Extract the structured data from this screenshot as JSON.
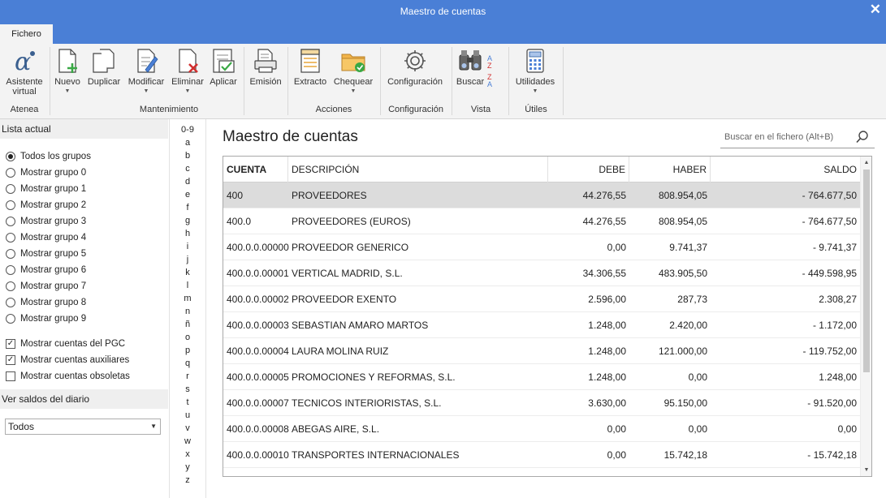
{
  "window": {
    "title": "Maestro de cuentas",
    "close_symbol": "✕"
  },
  "tabs": [
    {
      "label": "Fichero"
    }
  ],
  "ribbon": {
    "buttons": {
      "asistente": {
        "label1": "Asistente",
        "label2": "virtual"
      },
      "nuevo": {
        "label": "Nuevo"
      },
      "duplicar": {
        "label": "Duplicar"
      },
      "modificar": {
        "label": "Modificar"
      },
      "eliminar": {
        "label": "Eliminar"
      },
      "aplicar": {
        "label": "Aplicar"
      },
      "emision": {
        "label": "Emisión"
      },
      "extracto": {
        "label": "Extracto"
      },
      "chequear": {
        "label": "Chequear"
      },
      "configuracion": {
        "label": "Configuración"
      },
      "buscar": {
        "label": "Buscar"
      },
      "utilidades": {
        "label": "Utilidades"
      }
    },
    "sort_icons": {
      "az": "A",
      "az2": "Z",
      "za": "Z",
      "za2": "A"
    },
    "groups": {
      "atenea": "Atenea",
      "mantenimiento": "Mantenimiento",
      "acciones": "Acciones",
      "configuracion": "Configuración",
      "vista": "Vista",
      "utiles": "Útiles"
    }
  },
  "left_panel": {
    "lista_actual": "Lista actual",
    "radios": [
      {
        "label": "Todos los grupos",
        "checked": true
      },
      {
        "label": "Mostrar grupo 0",
        "checked": false
      },
      {
        "label": "Mostrar grupo 1",
        "checked": false
      },
      {
        "label": "Mostrar grupo 2",
        "checked": false
      },
      {
        "label": "Mostrar grupo 3",
        "checked": false
      },
      {
        "label": "Mostrar grupo 4",
        "checked": false
      },
      {
        "label": "Mostrar grupo 5",
        "checked": false
      },
      {
        "label": "Mostrar grupo 6",
        "checked": false
      },
      {
        "label": "Mostrar grupo 7",
        "checked": false
      },
      {
        "label": "Mostrar grupo 8",
        "checked": false
      },
      {
        "label": "Mostrar grupo 9",
        "checked": false
      }
    ],
    "checks": [
      {
        "label": "Mostrar cuentas del PGC",
        "checked": true
      },
      {
        "label": "Mostrar cuentas auxiliares",
        "checked": true
      },
      {
        "label": "Mostrar cuentas obsoletas",
        "checked": false
      }
    ],
    "ver_saldos": "Ver saldos del diario",
    "saldos_value": "Todos"
  },
  "alphabet": [
    "0-9",
    "a",
    "b",
    "c",
    "d",
    "e",
    "f",
    "g",
    "h",
    "i",
    "j",
    "k",
    "l",
    "m",
    "n",
    "ñ",
    "o",
    "p",
    "q",
    "r",
    "s",
    "t",
    "u",
    "v",
    "w",
    "x",
    "y",
    "z"
  ],
  "main": {
    "title": "Maestro de cuentas",
    "search_placeholder": "Buscar en el fichero (Alt+B)"
  },
  "table": {
    "headers": [
      "CUENTA",
      "DESCRIPCIÓN",
      "DEBE",
      "HABER",
      "SALDO"
    ],
    "rows": [
      {
        "cuenta": "400",
        "descripcion": "PROVEEDORES",
        "debe": "44.276,55",
        "haber": "808.954,05",
        "saldo": "- 764.677,50",
        "selected": true
      },
      {
        "cuenta": "400.0",
        "descripcion": "PROVEEDORES (EUROS)",
        "debe": "44.276,55",
        "haber": "808.954,05",
        "saldo": "- 764.677,50"
      },
      {
        "cuenta": "400.0.0.00000",
        "descripcion": "PROVEEDOR GENERICO",
        "debe": "0,00",
        "haber": "9.741,37",
        "saldo": "- 9.741,37"
      },
      {
        "cuenta": "400.0.0.00001",
        "descripcion": "VERTICAL MADRID, S.L.",
        "debe": "34.306,55",
        "haber": "483.905,50",
        "saldo": "- 449.598,95"
      },
      {
        "cuenta": "400.0.0.00002",
        "descripcion": "PROVEEDOR EXENTO",
        "debe": "2.596,00",
        "haber": "287,73",
        "saldo": "2.308,27"
      },
      {
        "cuenta": "400.0.0.00003",
        "descripcion": "SEBASTIAN AMARO MARTOS",
        "debe": "1.248,00",
        "haber": "2.420,00",
        "saldo": "- 1.172,00"
      },
      {
        "cuenta": "400.0.0.00004",
        "descripcion": "LAURA MOLINA RUIZ",
        "debe": "1.248,00",
        "haber": "121.000,00",
        "saldo": "- 119.752,00"
      },
      {
        "cuenta": "400.0.0.00005",
        "descripcion": "PROMOCIONES Y REFORMAS, S.L.",
        "debe": "1.248,00",
        "haber": "0,00",
        "saldo": "1.248,00"
      },
      {
        "cuenta": "400.0.0.00007",
        "descripcion": "TECNICOS INTERIORISTAS, S.L.",
        "debe": "3.630,00",
        "haber": "95.150,00",
        "saldo": "- 91.520,00"
      },
      {
        "cuenta": "400.0.0.00008",
        "descripcion": "ABEGAS AIRE, S.L.",
        "debe": "0,00",
        "haber": "0,00",
        "saldo": "0,00"
      },
      {
        "cuenta": "400.0.0.00010",
        "descripcion": "TRANSPORTES INTERNACIONALES",
        "debe": "0,00",
        "haber": "15.742,18",
        "saldo": "- 15.742,18"
      }
    ]
  },
  "colors": {
    "titlebar": "#4a7fd6",
    "ribbon_bg": "#f3f3f3",
    "selected_row": "#dcdcdc",
    "accent_green": "#3aa845",
    "accent_red": "#d22f2f",
    "accent_orange": "#e9a53a"
  }
}
